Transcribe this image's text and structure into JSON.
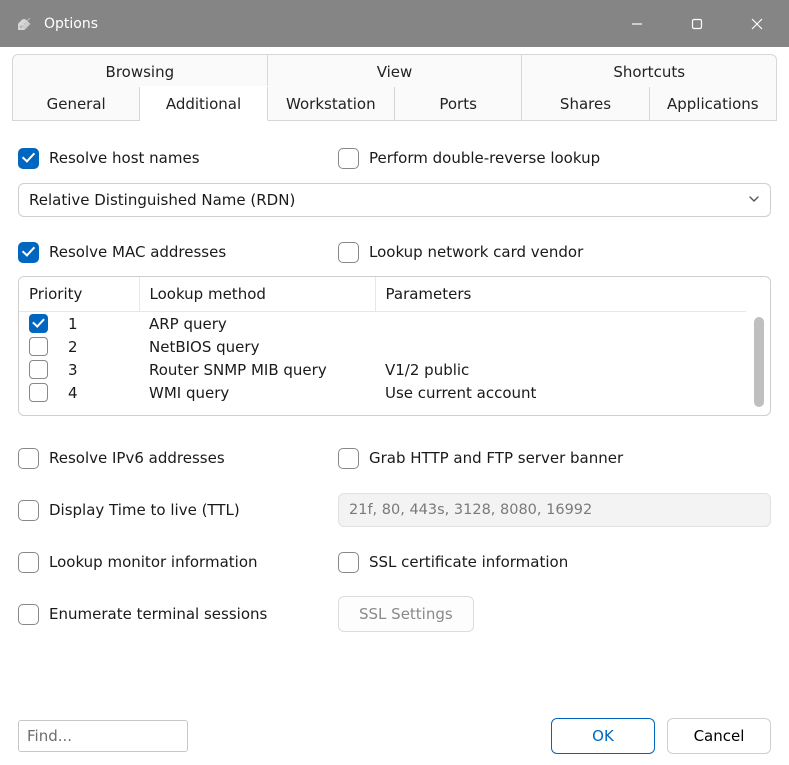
{
  "window": {
    "title": "Options"
  },
  "tabs": {
    "row1": [
      "Browsing",
      "View",
      "Shortcuts"
    ],
    "row2": [
      "General",
      "Additional",
      "Workstation",
      "Ports",
      "Shares",
      "Applications"
    ],
    "active": "Additional"
  },
  "pane": {
    "resolve_host": {
      "label": "Resolve host names",
      "checked": true
    },
    "double_reverse": {
      "label": "Perform double-reverse lookup",
      "checked": false
    },
    "nameformat": {
      "value": "Relative Distinguished Name (RDN)"
    },
    "resolve_mac": {
      "label": "Resolve MAC addresses",
      "checked": true
    },
    "lookup_vendor": {
      "label": "Lookup network card vendor",
      "checked": false
    },
    "lookup_table": {
      "headers": {
        "priority": "Priority",
        "method": "Lookup method",
        "parameters": "Parameters"
      },
      "rows": [
        {
          "checked": true,
          "priority": "1",
          "method": "ARP query",
          "parameters": ""
        },
        {
          "checked": false,
          "priority": "2",
          "method": "NetBIOS query",
          "parameters": ""
        },
        {
          "checked": false,
          "priority": "3",
          "method": "Router SNMP MIB query",
          "parameters": "V1/2 public"
        },
        {
          "checked": false,
          "priority": "4",
          "method": "WMI query",
          "parameters": "Use current account"
        }
      ]
    },
    "resolve_ipv6": {
      "label": "Resolve IPv6 addresses",
      "checked": false
    },
    "grab_banner": {
      "label": "Grab HTTP and FTP server banner",
      "checked": false
    },
    "display_ttl": {
      "label": "Display Time to live (TTL)",
      "checked": false
    },
    "ports_field": {
      "value": "21f, 80, 443s, 3128, 8080, 16992"
    },
    "lookup_monitor": {
      "label": "Lookup monitor information",
      "checked": false
    },
    "ssl_cert": {
      "label": "SSL certificate information",
      "checked": false
    },
    "enum_terminal": {
      "label": "Enumerate terminal sessions",
      "checked": false
    },
    "ssl_settings_btn": {
      "label": "SSL Settings"
    }
  },
  "footer": {
    "find_placeholder": "Find...",
    "ok": "OK",
    "cancel": "Cancel"
  }
}
